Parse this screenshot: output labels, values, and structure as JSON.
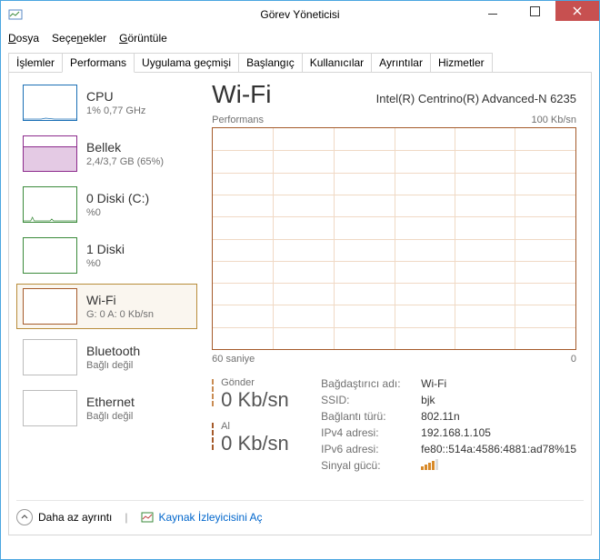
{
  "window": {
    "title": "Görev Yöneticisi"
  },
  "menu": {
    "file": "Dosya",
    "options": "Seçenekler",
    "view": "Görüntüle"
  },
  "tabs": {
    "processes": "İşlemler",
    "performance": "Performans",
    "history": "Uygulama geçmişi",
    "startup": "Başlangıç",
    "users": "Kullanıcılar",
    "details": "Ayrıntılar",
    "services": "Hizmetler"
  },
  "sidebar": {
    "cpu": {
      "title": "CPU",
      "sub": "1% 0,77 GHz"
    },
    "mem": {
      "title": "Bellek",
      "sub": "2,4/3,7 GB (65%)"
    },
    "disk0": {
      "title": "0 Diski (C:)",
      "sub": "%0"
    },
    "disk1": {
      "title": "1 Diski",
      "sub": "%0"
    },
    "wifi": {
      "title": "Wi-Fi",
      "sub": "G: 0 A: 0 Kb/sn"
    },
    "bt": {
      "title": "Bluetooth",
      "sub": "Bağlı değil"
    },
    "eth": {
      "title": "Ethernet",
      "sub": "Bağlı değil"
    }
  },
  "main": {
    "title": "Wi-Fi",
    "adapter": "Intel(R) Centrino(R) Advanced-N 6235",
    "chart_top_left": "Performans",
    "chart_top_right": "100 Kb/sn",
    "chart_bottom_left": "60 saniye",
    "chart_bottom_right": "0"
  },
  "rates": {
    "send_label": "Gönder",
    "send_value": "0 Kb/sn",
    "recv_label": "Al",
    "recv_value": "0 Kb/sn"
  },
  "props": {
    "adapter_name_k": "Bağdaştırıcı adı:",
    "adapter_name_v": "Wi-Fi",
    "ssid_k": "SSID:",
    "ssid_v": "bjk",
    "conn_type_k": "Bağlantı türü:",
    "conn_type_v": "802.11n",
    "ipv4_k": "IPv4 adresi:",
    "ipv4_v": "192.168.1.105",
    "ipv6_k": "IPv6 adresi:",
    "ipv6_v": "fe80::514a:4586:4881:ad78%15",
    "signal_k": "Sinyal gücü:"
  },
  "footer": {
    "less": "Daha az ayrıntı",
    "resmon": "Kaynak İzleyicisini Aç"
  },
  "chart_data": {
    "type": "line",
    "title": "Wi-Fi Performans",
    "xlabel": "saniye",
    "ylabel": "Kb/sn",
    "xlim": [
      0,
      60
    ],
    "ylim": [
      0,
      100
    ],
    "series": [
      {
        "name": "Gönder",
        "values": [
          0,
          0,
          0,
          0,
          0,
          0,
          0,
          0,
          0,
          0
        ]
      },
      {
        "name": "Al",
        "values": [
          0,
          0,
          0,
          0,
          0,
          0,
          0,
          0,
          0,
          0
        ]
      }
    ]
  }
}
